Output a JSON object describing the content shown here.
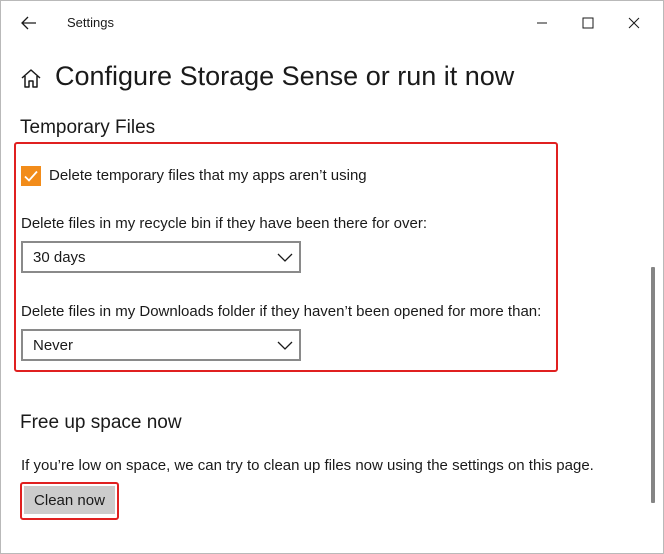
{
  "window": {
    "title": "Settings"
  },
  "header": {
    "page_title": "Configure Storage Sense or run it now"
  },
  "temporary_files": {
    "section_title": "Temporary Files",
    "delete_temp_checkbox": {
      "label": "Delete temporary files that my apps aren’t using",
      "checked": true
    },
    "recycle_bin": {
      "label": "Delete files in my recycle bin if they have been there for over:",
      "selected": "30 days"
    },
    "downloads": {
      "label": "Delete files in my Downloads folder if they haven’t been opened for more than:",
      "selected": "Never"
    }
  },
  "free_up_space": {
    "section_title": "Free up space now",
    "description": "If you’re low on space, we can try to clean up files now using the settings on this page.",
    "button_label": "Clean now"
  },
  "colors": {
    "accent": "#f28c1a",
    "highlight": "#e02020",
    "button_bg": "#cccccc"
  },
  "icons": {
    "back": "arrow-left-icon",
    "home": "home-icon",
    "minimize": "minimize-icon",
    "maximize": "maximize-icon",
    "close": "close-icon",
    "checkmark": "checkmark-icon",
    "dropdown": "chevron-down-icon"
  }
}
